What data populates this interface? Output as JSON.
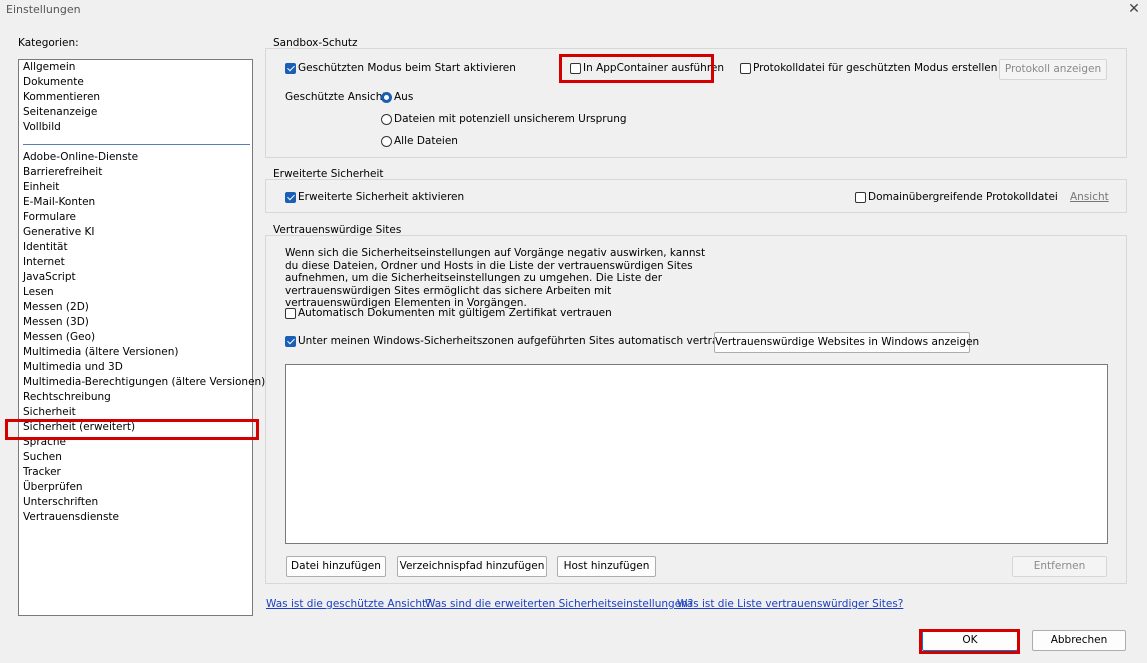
{
  "window": {
    "title": "Einstellungen",
    "close_glyph": "✕"
  },
  "categories": {
    "label": "Kategorien:",
    "top": [
      "Allgemein",
      "Dokumente",
      "Kommentieren",
      "Seitenanzeige",
      "Vollbild"
    ],
    "bottom": [
      "Adobe-Online-Dienste",
      "Barrierefreiheit",
      "Einheit",
      "E-Mail-Konten",
      "Formulare",
      "Generative KI",
      "Identität",
      "Internet",
      "JavaScript",
      "Lesen",
      "Messen (2D)",
      "Messen (3D)",
      "Messen (Geo)",
      "Multimedia (ältere Versionen)",
      "Multimedia und 3D",
      "Multimedia-Berechtigungen (ältere Versionen)",
      "Rechtschreibung",
      "Sicherheit",
      "Sicherheit (erweitert)",
      "Sprache",
      "Suchen",
      "Tracker",
      "Überprüfen",
      "Unterschriften",
      "Vertrauensdienste"
    ],
    "selected": "Sicherheit (erweitert)"
  },
  "sandbox": {
    "title": "Sandbox-Schutz",
    "protected_mode": {
      "label": "Geschützten Modus beim Start aktivieren",
      "checked": true
    },
    "appcontainer": {
      "label": "In AppContainer ausführen",
      "checked": false
    },
    "logfile": {
      "label": "Protokolldatei für geschützten Modus erstellen",
      "checked": false
    },
    "show_log_button": "Protokoll anzeigen",
    "protected_view_label": "Geschützte Ansicht",
    "options": [
      {
        "label": "Aus",
        "checked": true
      },
      {
        "label": "Dateien mit potenziell unsicherem Ursprung",
        "checked": false
      },
      {
        "label": "Alle Dateien",
        "checked": false
      }
    ]
  },
  "enhanced": {
    "title": "Erweiterte Sicherheit",
    "enable": {
      "label": "Erweiterte Sicherheit aktivieren",
      "checked": true
    },
    "crossdomain": {
      "label": "Domainübergreifende Protokolldatei",
      "checked": false
    },
    "view_link": "Ansicht"
  },
  "trusted": {
    "title": "Vertrauenswürdige Sites",
    "description": "Wenn sich die Sicherheitseinstellungen auf Vorgänge negativ auswirken, kannst du diese Dateien, Ordner und Hosts in die Liste der vertrauenswürdigen Sites aufnehmen, um die Sicherheitseinstellungen zu umgehen. Die Liste der vertrauenswürdigen Sites ermöglicht das sichere Arbeiten mit vertrauenswürdigen Elementen in Vorgängen.",
    "auto_cert": {
      "label": "Automatisch Dokumenten mit gültigem Zertifikat vertrauen",
      "checked": false
    },
    "win_zones": {
      "label": "Unter meinen Windows-Sicherheitszonen aufgeführten Sites automatisch vertrauen",
      "checked": true
    },
    "show_win_button": "Vertrauenswürdige Websites in Windows anzeigen",
    "buttons": {
      "add_file": "Datei hinzufügen",
      "add_folder": "Verzeichnispfad hinzufügen",
      "add_host": "Host hinzufügen",
      "remove": "Entfernen"
    }
  },
  "links": {
    "protected_view": "Was ist die geschützte Ansicht?",
    "enhanced": "Was sind die erweiterten Sicherheitseinstellungen?",
    "trusted": "Was ist die Liste vertrauenswürdiger Sites?"
  },
  "footer": {
    "ok": "OK",
    "cancel": "Abbrechen"
  },
  "colors": {
    "highlight": "#d40000",
    "accent": "#1a5fb4",
    "link": "#1a3fc4"
  }
}
